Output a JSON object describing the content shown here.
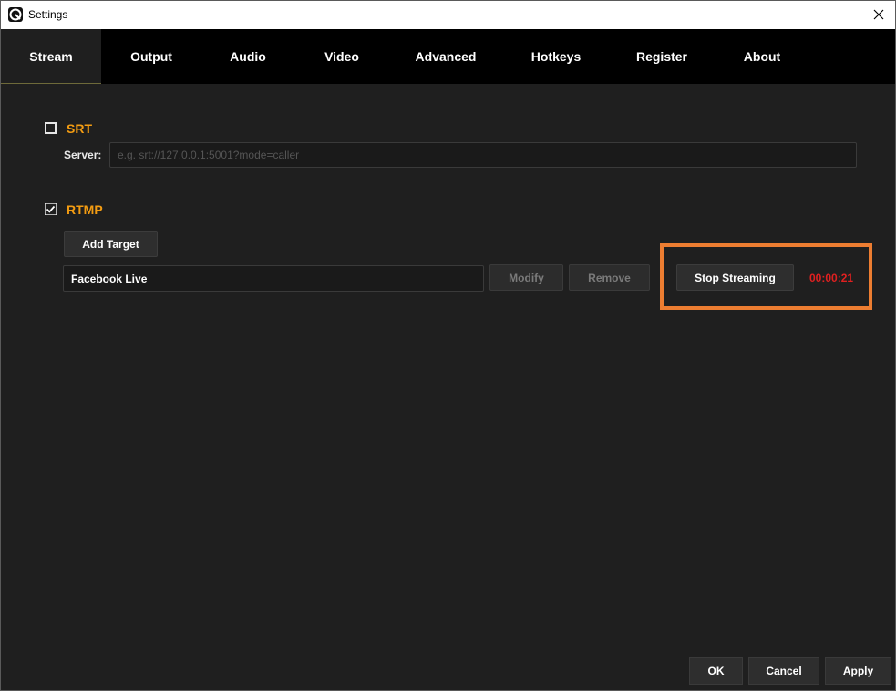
{
  "window": {
    "title": "Settings",
    "close_glyph": "✕"
  },
  "tabs": [
    {
      "label": "Stream",
      "active": true
    },
    {
      "label": "Output",
      "active": false
    },
    {
      "label": "Audio",
      "active": false
    },
    {
      "label": "Video",
      "active": false
    },
    {
      "label": "Advanced",
      "active": false
    },
    {
      "label": "Hotkeys",
      "active": false
    },
    {
      "label": "Register",
      "active": false
    },
    {
      "label": "About",
      "active": false
    }
  ],
  "srt": {
    "label": "SRT",
    "checked": false,
    "server_label": "Server:",
    "server_value": "",
    "server_placeholder": "e.g. srt://127.0.0.1:5001?mode=caller"
  },
  "rtmp": {
    "label": "RTMP",
    "checked": true,
    "add_target_label": "Add Target",
    "target_name": "Facebook Live",
    "modify_label": "Modify",
    "remove_label": "Remove",
    "stop_streaming_label": "Stop Streaming",
    "elapsed": "00:00:21"
  },
  "footer": {
    "ok_label": "OK",
    "cancel_label": "Cancel",
    "apply_label": "Apply"
  },
  "colors": {
    "accent_orange": "#f39c12",
    "highlight_border": "#ed7d31",
    "timer_red": "#e02020"
  }
}
